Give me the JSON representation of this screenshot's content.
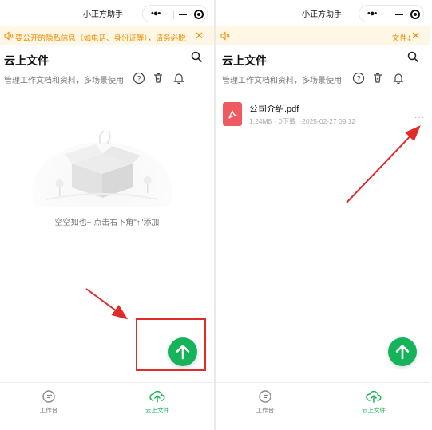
{
  "left": {
    "window_title": "小正方助手",
    "notice_text": "要公开的隐私信息（如电话、身份证等），请务必脱",
    "page_title": "云上文件",
    "subtitle": "管理工作文档和资料，多场景使用",
    "empty_text": "空空如也~ 点击右下角\"↑\"添加",
    "tabs": [
      {
        "label": "工作台",
        "icon": "workbench-icon",
        "active": false
      },
      {
        "label": "云上文件",
        "icon": "cloud-upload-icon",
        "active": true
      }
    ]
  },
  "right": {
    "window_title": "小正方助手",
    "notice_text": "文件‡",
    "page_title": "云上文件",
    "subtitle": "管理工作文档和资料，多场景使用",
    "file": {
      "name": "公司介绍.pdf",
      "meta": "1.24MB · 0下载 · 2025-02-27 09:12",
      "more": "···"
    },
    "tabs": [
      {
        "label": "工作台",
        "icon": "workbench-icon",
        "active": false
      },
      {
        "label": "云上文件",
        "icon": "cloud-upload-icon",
        "active": true
      }
    ]
  },
  "colors": {
    "accent_green": "#16b45a",
    "notice_bg": "#fff7e6",
    "notice_text": "#f08c00",
    "annotation_red": "#e02b2b",
    "pdf_red": "#ef5a61"
  }
}
